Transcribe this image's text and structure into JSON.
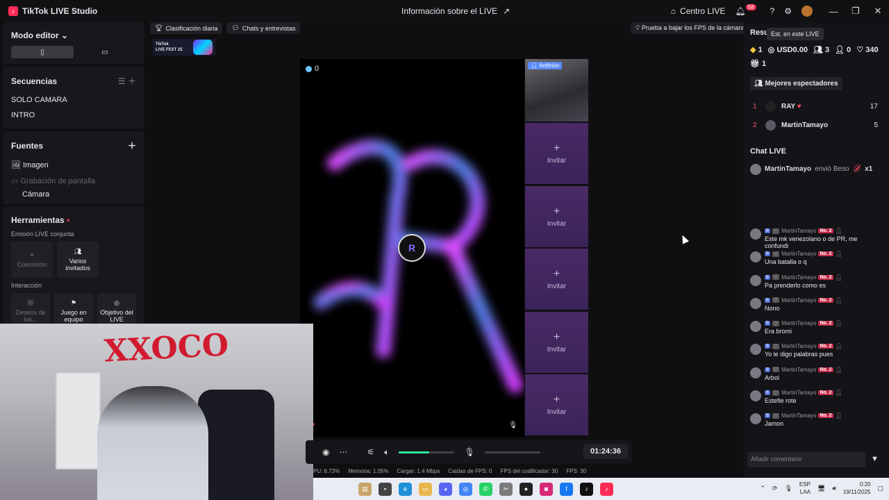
{
  "app": {
    "title": "TikTok LIVE Studio",
    "center_title": "Información sobre el LIVE"
  },
  "titlebar": {
    "centro_live": "Centro LIVE",
    "notif_count": "58"
  },
  "left": {
    "mode_label": "Modo editor",
    "sequences_h": "Secuencias",
    "sequences": [
      "SOLO CAMARA",
      "INTRO"
    ],
    "sources_h": "Fuentes",
    "sources": [
      "Imagen",
      "Grabación de pantalla",
      "Cámara"
    ],
    "tools_h": "Herramientas",
    "emission_h": "Emisión LIVE conjunta",
    "emission_tools": [
      "Coemisión",
      "Varios invitados"
    ],
    "interaction_h": "Interacción",
    "interaction_tools": [
      "Deseos de los...",
      "Juego en equipo",
      "Objetivo del LIVE"
    ]
  },
  "toptags": {
    "daily": "Clasificación diaria",
    "chats": "Chats y entrevistas",
    "fps_tip": "Prueba a bajar los FPS de la cámara"
  },
  "livefest": {
    "line1": "TikTok",
    "line2": "LIVE FEST 25"
  },
  "stage": {
    "viewers": "0",
    "host_name": "AY",
    "center_letter": "R"
  },
  "invite": {
    "host_tag": "Anfitrión",
    "invite_label": "Invitar",
    "slots": 5
  },
  "webcam": {
    "graffiti": "XXOCO"
  },
  "controls": {
    "timer": "01:24:36",
    "volume": 0.55
  },
  "stats": {
    "cpu": "PU: 6.73%",
    "mem": "Memoria: 1.05%",
    "upload": "Cargar: 1.4 Mbps",
    "drops": "Caídas de FPS: 0",
    "enc_fps": "FPS del codificador: 30",
    "fps": "FPS: 30"
  },
  "right": {
    "res_title": "Resu",
    "tooltip": "Est. en este LIVE",
    "stats": {
      "diamonds": "1",
      "usd": "USD0.00",
      "viewers": "3",
      "follows": "0",
      "likes": "340",
      "gifts": "1"
    },
    "best_btn": "Mejores espectadores",
    "best": [
      {
        "rank": "1",
        "name": "RAY",
        "score": "17"
      },
      {
        "rank": "2",
        "name": "MartinTamayo",
        "score": "5"
      }
    ],
    "chat_h": "Chat LIVE",
    "gift": {
      "user": "MartinTamayo",
      "text": "envió Beso",
      "mult": "x1"
    },
    "chat_user": "MartinTamayo",
    "lvl": "8",
    "rank_tag": "No. 2",
    "messages": [
      "Este mk venezolano o de PR, me confundi",
      "Una batalla o q",
      "Pa prenderlo como es",
      "Nono",
      "Era bromi",
      "Yo le digo palabras pues",
      "Arbol",
      "Estefie rote",
      "Jamon"
    ],
    "comment_placeholder": "Añadir comentario"
  },
  "taskbar": {
    "lang": "ESP",
    "lang2": "LAA",
    "time": "0:20",
    "date": "19/11/2025"
  },
  "colors": {
    "accent": "#ff2d55",
    "invite_bg": "#4a2a66",
    "volume": "#2ee6a0"
  }
}
